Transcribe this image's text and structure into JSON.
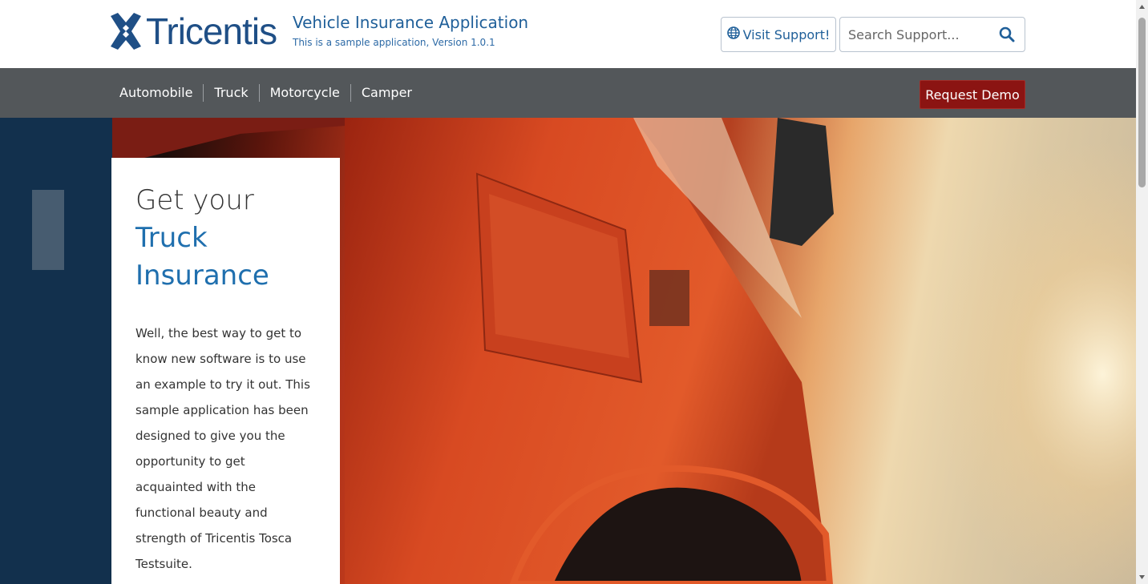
{
  "header": {
    "logo_text": "Tricentis",
    "app_title": "Vehicle Insurance Application",
    "app_subtitle": "This is a sample application, Version 1.0.1",
    "support_label": "Visit Support!",
    "search_placeholder": "Search Support..."
  },
  "nav": {
    "items": [
      {
        "label": "Automobile"
      },
      {
        "label": "Truck"
      },
      {
        "label": "Motorcycle"
      },
      {
        "label": "Camper"
      }
    ],
    "demo_label": "Request Demo"
  },
  "hero": {
    "heading_line1": "Get your",
    "heading_line2": "Truck",
    "heading_line3": "Insurance",
    "body": "Well, the best way to get to know new software is to use an example to try it out. This sample application has been designed to give you the opportunity to get acquainted with the functional beauty and strength of Tricentis Tosca Testsuite."
  },
  "colors": {
    "brand_blue": "#1f4f86",
    "nav_bg": "#53575a",
    "demo_red": "#8b1412"
  },
  "icons": {
    "logo": "tricentis-x-icon",
    "support": "globe-icon",
    "search": "search-icon"
  }
}
